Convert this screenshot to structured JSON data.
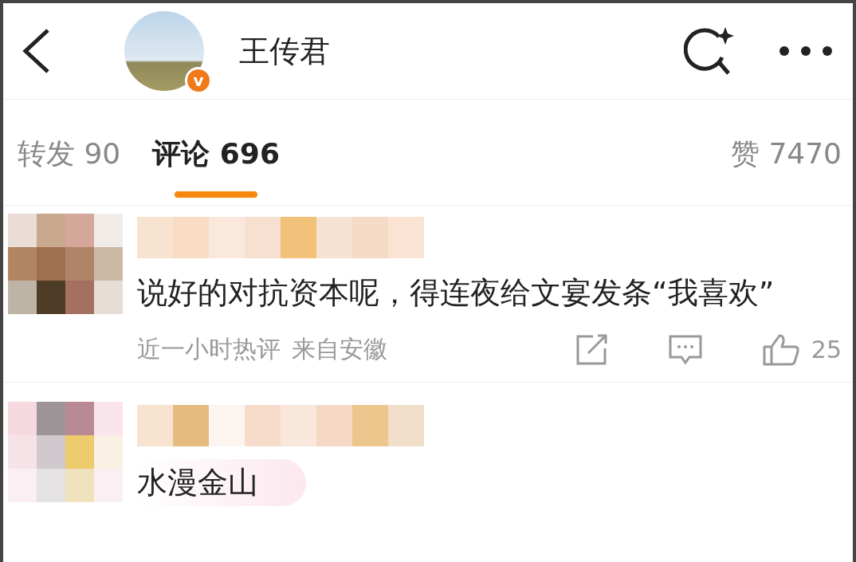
{
  "header": {
    "title": "王传君",
    "verified_badge": "v"
  },
  "tabs": [
    {
      "label": "转发",
      "count": "90",
      "selected": false
    },
    {
      "label": "评论",
      "count": "696",
      "selected": true
    },
    {
      "label": "赞",
      "count": "7470",
      "selected": false
    }
  ],
  "comments": [
    {
      "text": "说好的对抗资本呢，得连夜给文宴发条“我喜欢”",
      "meta": "近一小时热评",
      "location": "来自安徽",
      "likes": "25"
    },
    {
      "text": "水漫金山"
    }
  ]
}
